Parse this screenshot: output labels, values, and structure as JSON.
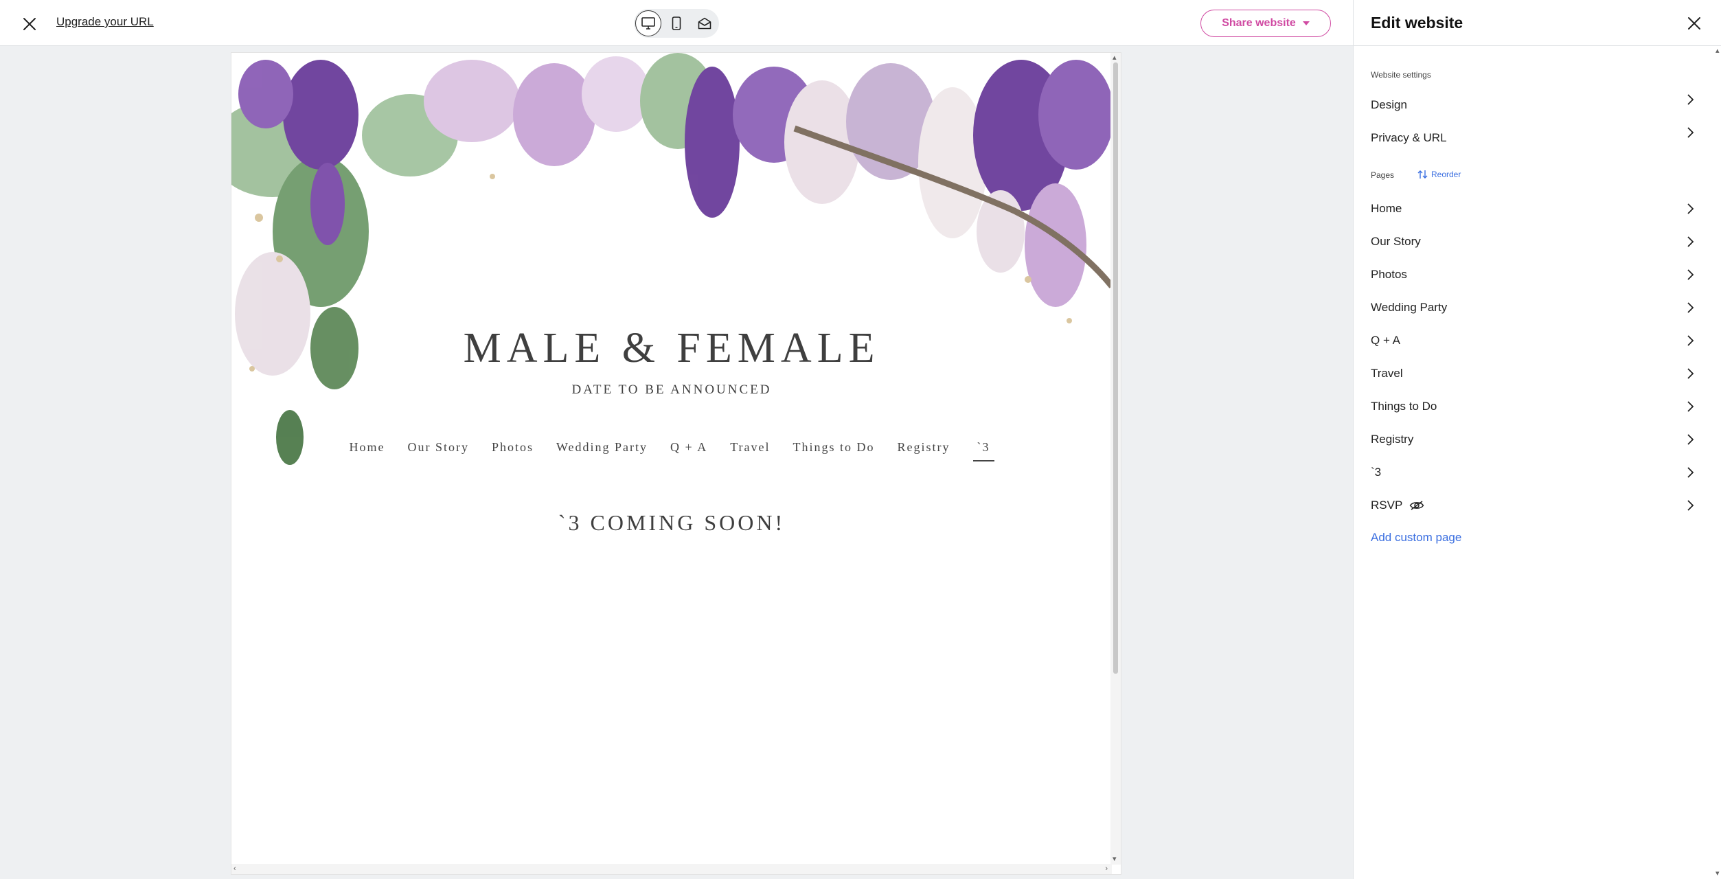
{
  "topbar": {
    "upgrade_link": "Upgrade your URL",
    "share_button": "Share website"
  },
  "site": {
    "couple_names": "MALE & FEMALE",
    "date": "DATE TO BE ANNOUNCED",
    "nav": [
      "Home",
      "Our Story",
      "Photos",
      "Wedding Party",
      "Q + A",
      "Travel",
      "Things to Do",
      "Registry",
      "`3"
    ],
    "active_nav": "`3",
    "coming_soon": "`3 COMING SOON!"
  },
  "panel": {
    "title": "Edit website",
    "settings_label": "Website settings",
    "settings": [
      "Design",
      "Privacy & URL"
    ],
    "pages_label": "Pages",
    "reorder_label": "Reorder",
    "pages": [
      "Home",
      "Our Story",
      "Photos",
      "Wedding Party",
      "Q + A",
      "Travel",
      "Things to Do",
      "Registry",
      "`3",
      "RSVP"
    ],
    "hidden_page": "RSVP",
    "add_custom_page": "Add custom page"
  },
  "colors": {
    "accent_pink": "#d04aa2",
    "link_blue": "#3a6ee0",
    "purple_flower": "#6a3d9a",
    "lilac_flower": "#c9a6d6"
  },
  "icons": [
    "close-icon",
    "desktop-icon",
    "mobile-icon",
    "envelope-icon",
    "caret-down-icon",
    "chevron-right-icon",
    "reorder-arrows-icon",
    "hidden-eye-icon"
  ]
}
